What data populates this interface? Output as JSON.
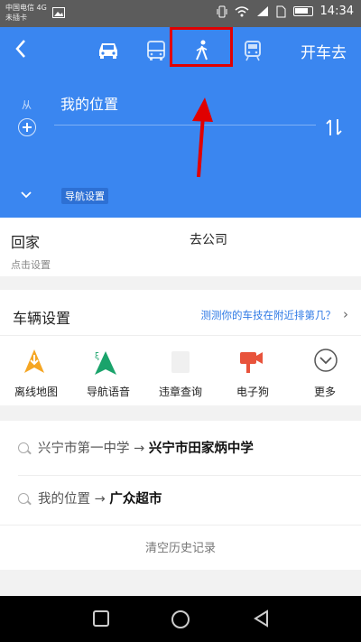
{
  "status_bar": {
    "carrier_line1": "中国电信 4G",
    "carrier_line2": "未插卡",
    "time": "14:34",
    "icons": [
      "image-icon",
      "vibrate-icon",
      "wifi-icon",
      "signal-icon",
      "sim-icon",
      "battery-icon"
    ]
  },
  "route_header": {
    "modes": [
      "car-icon",
      "bus-icon",
      "walk-icon",
      "train-icon"
    ],
    "selected_mode": "walk-icon",
    "drive_button": "开车去",
    "from_label": "从",
    "from_value": "我的位置",
    "nav_settings": "导航设置"
  },
  "colors": {
    "header_blue": "#3a86f0",
    "highlight_red": "#e00000",
    "link_blue": "#2f7ae5",
    "offline_orange": "#f5a623",
    "voice_green": "#1aa36b",
    "camera_red": "#e8533b"
  },
  "home": {
    "title": "回家",
    "subtitle": "点击设置",
    "company_partial": "去公司"
  },
  "vehicle": {
    "title": "车辆设置",
    "link": "测测你的车技在附近排第几？",
    "items": [
      {
        "label": "离线地图",
        "icon": "offline-map-icon"
      },
      {
        "label": "导航语音",
        "icon": "nav-voice-icon"
      },
      {
        "label": "违章查询",
        "icon": "violation-icon"
      },
      {
        "label": "电子狗",
        "icon": "camera-icon"
      },
      {
        "label": "更多",
        "icon": "more-icon"
      }
    ]
  },
  "history": {
    "items": [
      {
        "from": "兴宁市第一中学",
        "arrow": "→",
        "to": "兴宁市田家炳中学"
      },
      {
        "from": "我的位置",
        "arrow": "→",
        "to": "广众超市"
      }
    ],
    "clear_label": "清空历史记录"
  },
  "nav_bar": {
    "buttons": [
      "recent-apps-icon",
      "home-circle-icon",
      "back-triangle-icon"
    ]
  }
}
